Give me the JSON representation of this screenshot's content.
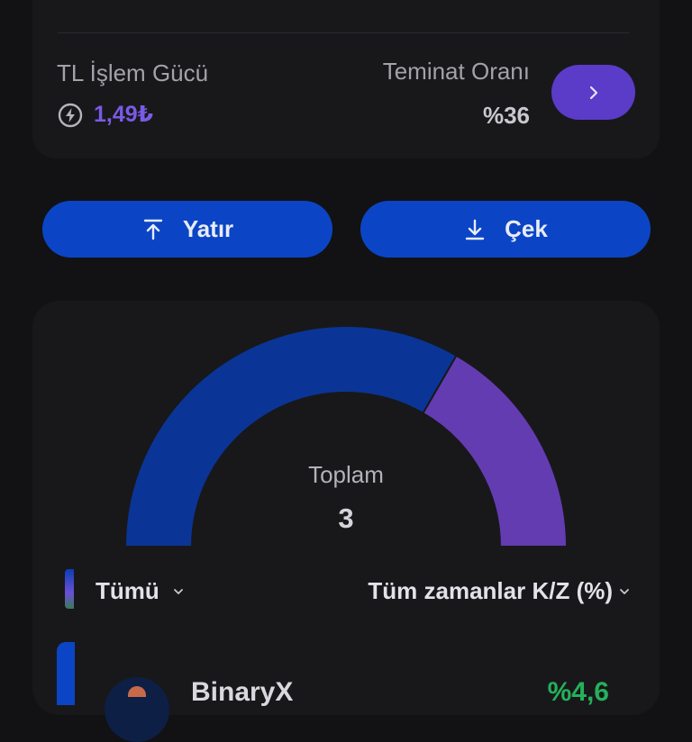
{
  "balance": {
    "power_label": "TL İşlem Gücü",
    "power_value": "1,49₺",
    "ratio_label": "Teminat Oranı",
    "ratio_value": "%36"
  },
  "actions": {
    "deposit_label": "Yatır",
    "withdraw_label": "Çek"
  },
  "chart_data": {
    "type": "pie",
    "style": "semi-donut",
    "center_label": "Toplam",
    "center_value": "3",
    "slices": [
      {
        "value": 2,
        "color": "#0a3597"
      },
      {
        "value": 1,
        "color": "#633cb2"
      }
    ]
  },
  "filters": {
    "category_label": "Tümü",
    "period_label": "Tüm zamanlar K/Z (%)"
  },
  "assets": [
    {
      "name": "BinaryX",
      "change": "%4,6"
    }
  ],
  "colors": {
    "background": "#121214",
    "card": "#18181b",
    "primary_blue": "#0b45c6",
    "accent_purple": "#5a3cc8",
    "positive_green": "#25b05a"
  },
  "icons": {
    "power": "lightning-circle-icon",
    "arrow": "chevron-right-icon",
    "deposit": "arrow-up-bar-icon",
    "withdraw": "arrow-down-bar-icon",
    "dropdown": "chevron-down-icon"
  }
}
